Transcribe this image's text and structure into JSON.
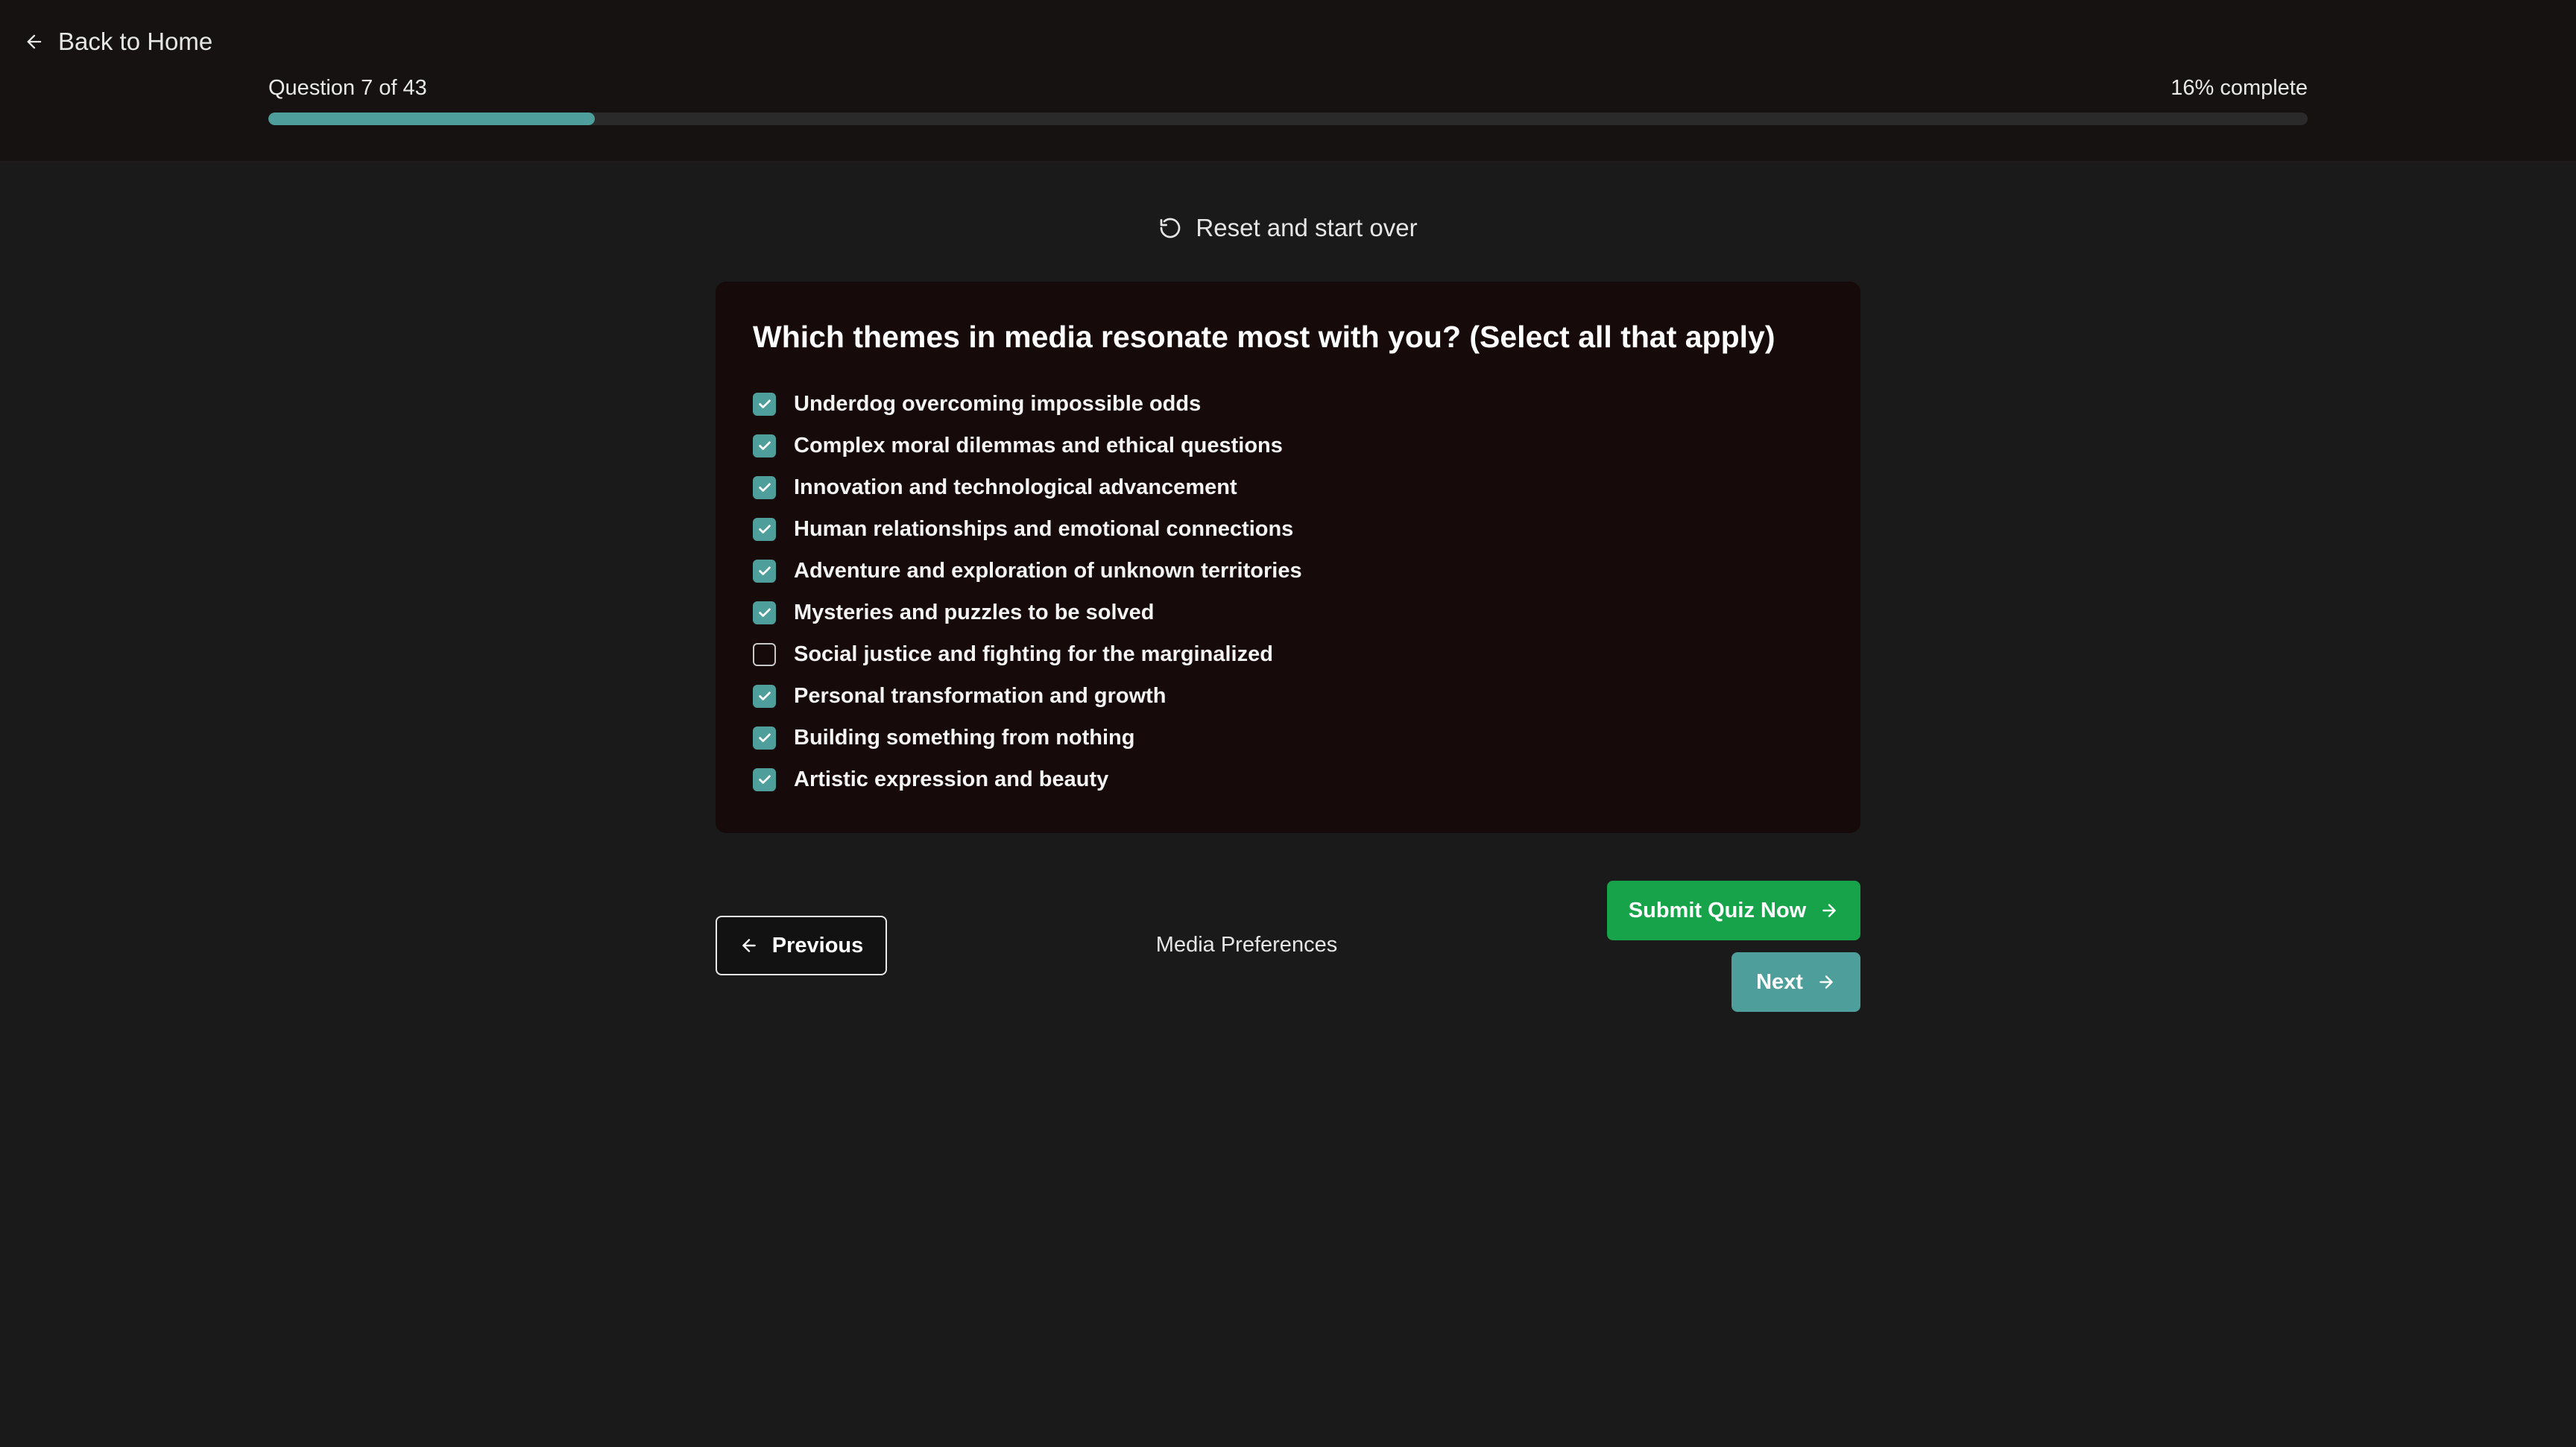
{
  "header": {
    "back_label": "Back to Home",
    "question_counter": "Question 7 of 43",
    "percent_label": "16% complete",
    "progress_fraction": 0.16,
    "accent_color": "#4e9e9c"
  },
  "reset": {
    "label": "Reset and start over",
    "icon": "rotate-ccw-icon"
  },
  "question": {
    "text": "Which themes in media resonate most with you? (Select all that apply)",
    "options": [
      {
        "label": "Underdog overcoming impossible odds",
        "checked": true
      },
      {
        "label": "Complex moral dilemmas and ethical questions",
        "checked": true
      },
      {
        "label": "Innovation and technological advancement",
        "checked": true
      },
      {
        "label": "Human relationships and emotional connections",
        "checked": true
      },
      {
        "label": "Adventure and exploration of unknown territories",
        "checked": true
      },
      {
        "label": "Mysteries and puzzles to be solved",
        "checked": true
      },
      {
        "label": "Social justice and fighting for the marginalized",
        "checked": false
      },
      {
        "label": "Personal transformation and growth",
        "checked": true
      },
      {
        "label": "Building something from nothing",
        "checked": true
      },
      {
        "label": "Artistic expression and beauty",
        "checked": true
      }
    ]
  },
  "footer": {
    "previous_label": "Previous",
    "section_label": "Media Preferences",
    "submit_label": "Submit Quiz Now",
    "next_label": "Next",
    "submit_color": "#16a34a"
  }
}
